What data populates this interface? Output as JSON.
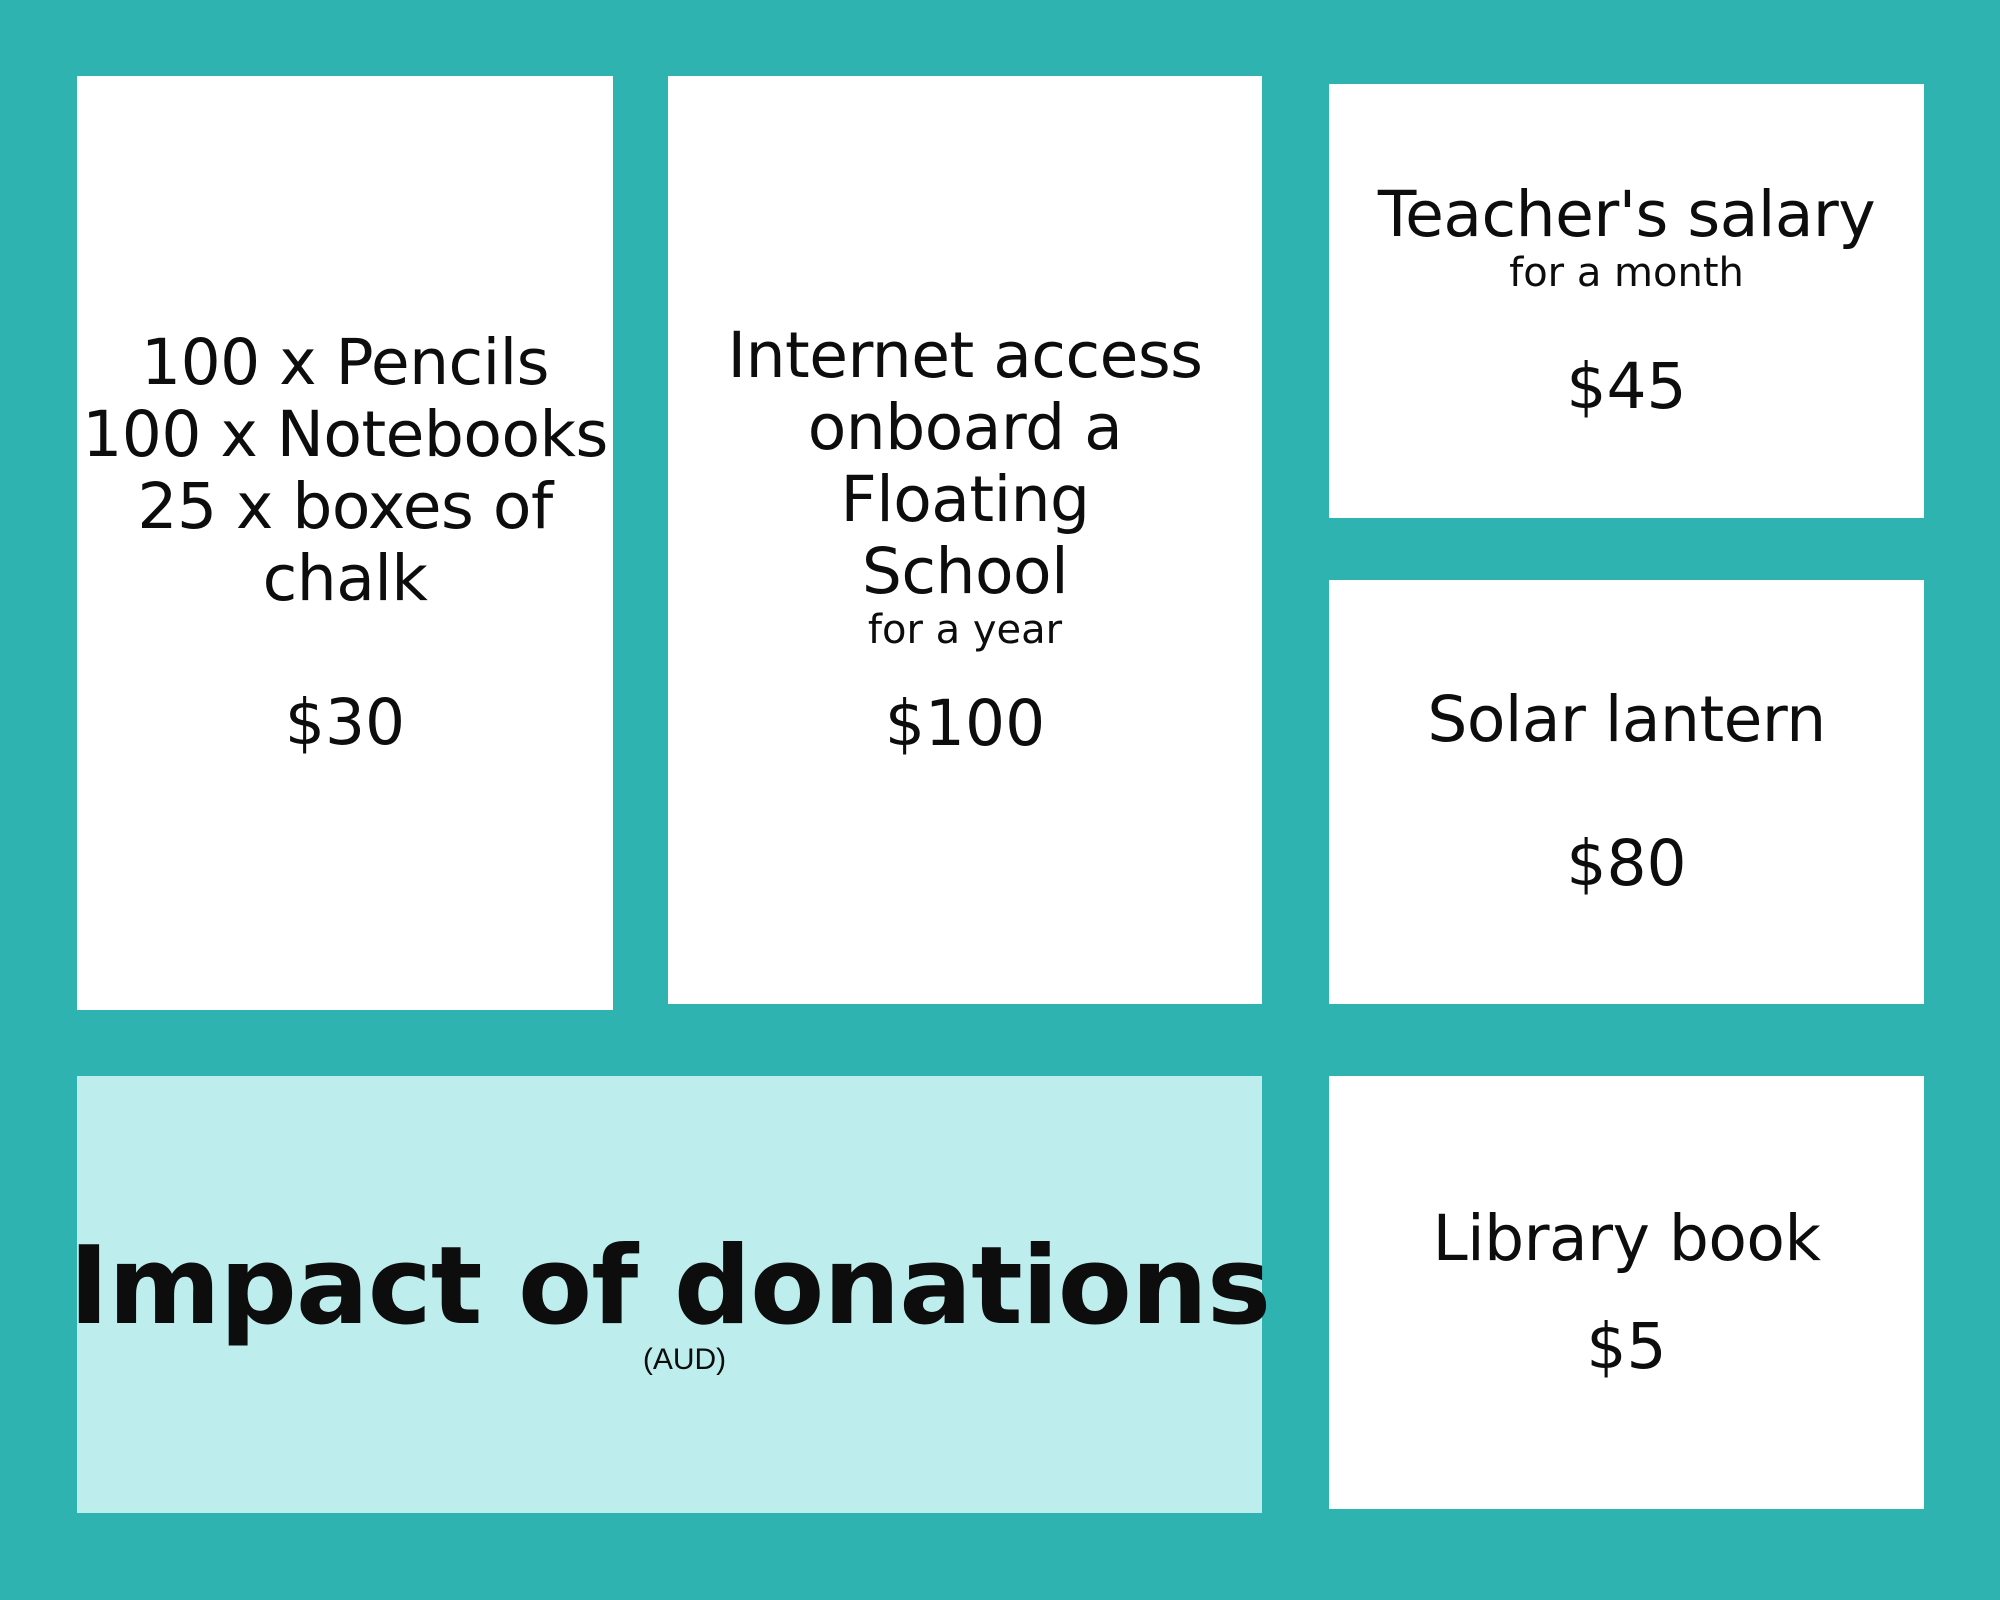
{
  "cards": {
    "supplies": {
      "lines": [
        "100 x Pencils",
        "100 x Notebooks",
        "25 x boxes of",
        "chalk"
      ],
      "price": "$30"
    },
    "internet": {
      "lines": [
        "Internet access",
        "onboard a",
        "Floating",
        "School"
      ],
      "subtitle": "for a year",
      "price": "$100"
    },
    "teacher": {
      "title": "Teacher's salary",
      "subtitle": "for a month",
      "price": "$45"
    },
    "lantern": {
      "title": "Solar lantern",
      "price": "$80"
    },
    "library": {
      "title": "Library book",
      "price": "$5"
    }
  },
  "impact": {
    "title": "Impact of donations",
    "currency_note": "(AUD)"
  },
  "colors": {
    "background": "#2fb3b0",
    "card": "#ffffff",
    "impact_panel": "#bdeeed",
    "text": "#0d0d0d"
  }
}
